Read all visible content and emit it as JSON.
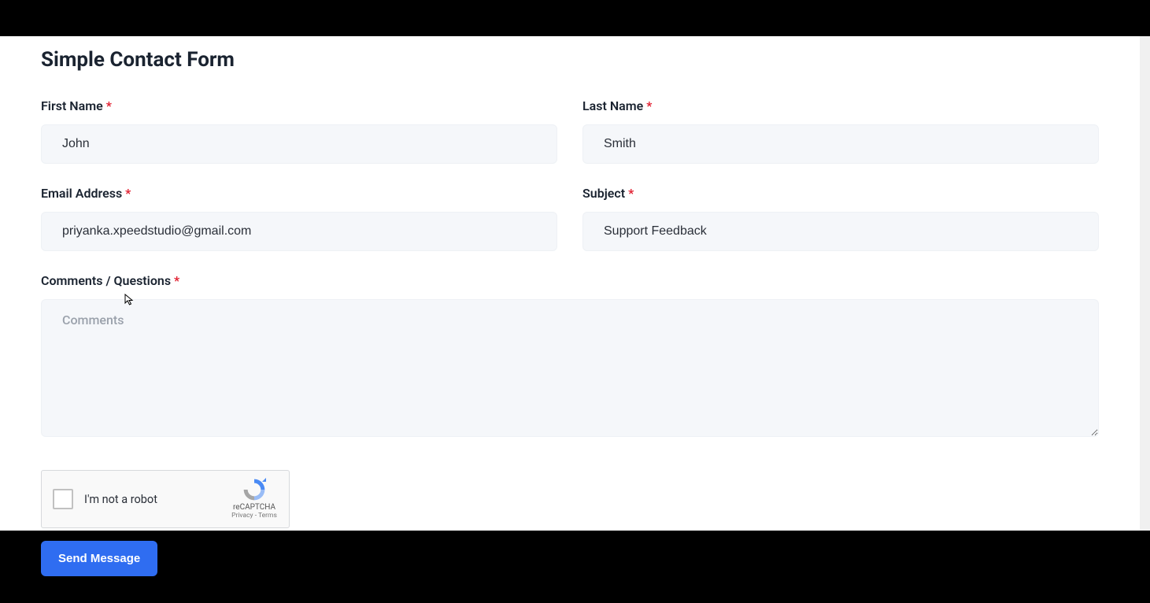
{
  "page": {
    "title": "Simple Contact Form"
  },
  "fields": {
    "first_name": {
      "label": "First Name",
      "value": "John",
      "required": true
    },
    "last_name": {
      "label": "Last Name",
      "value": "Smith",
      "required": true
    },
    "email": {
      "label": "Email Address",
      "value": "priyanka.xpeedstudio@gmail.com",
      "required": true
    },
    "subject": {
      "label": "Subject",
      "value": "Support Feedback",
      "required": true
    },
    "comments": {
      "label": "Comments / Questions",
      "placeholder": "Comments",
      "value": "",
      "required": true
    }
  },
  "recaptcha": {
    "label": "I'm not a robot",
    "brand": "reCAPTCHA",
    "links": "Privacy - Terms"
  },
  "submit": {
    "label": "Send Message"
  },
  "required_marker": "*"
}
